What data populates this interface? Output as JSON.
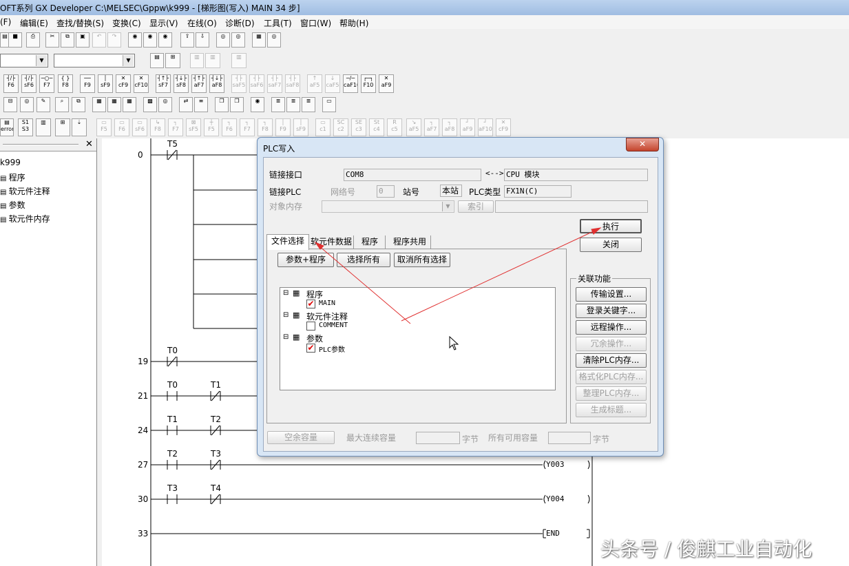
{
  "window": {
    "title": "OFT系列 GX Developer C:\\MELSEC\\Gppw\\k999 - [梯形图(写入)     MAIN    34 步]"
  },
  "menu": [
    "(F)",
    "编辑(E)",
    "查找/替换(S)",
    "变换(C)",
    "显示(V)",
    "在线(O)",
    "诊断(D)",
    "工具(T)",
    "窗口(W)",
    "帮助(H)"
  ],
  "toolbar3": [
    "F6",
    "sF6",
    "F7",
    "F8",
    "F9",
    "sF9",
    "cF9",
    "cF10",
    "sF7",
    "sF8",
    "aF7",
    "aF8",
    "saF5",
    "saF6",
    "saF7",
    "saF8",
    "aF5",
    "caF5",
    "caF10",
    "F10",
    "aF9"
  ],
  "toolbar5": [
    "F5",
    "F6",
    "sF6",
    "F8",
    "F7",
    "sF5",
    "F5",
    "F6",
    "F7",
    "F8",
    "F9",
    "sF9",
    "c1",
    "c2",
    "c3",
    "c4",
    "c5",
    "aF5",
    "aF7",
    "aF8",
    "aF9",
    "aF10",
    "cF9"
  ],
  "project": {
    "root": "k999",
    "items": [
      "程序",
      "软元件注释",
      "参数",
      "软元件内存"
    ]
  },
  "ladder": {
    "steps": [
      "0",
      "19",
      "21",
      "24",
      "27",
      "30",
      "33"
    ],
    "contacts": [
      "T5",
      "T0",
      "T0",
      "T1",
      "T1",
      "T2",
      "T2",
      "T3",
      "T3",
      "T4"
    ],
    "coils": [
      "Y003",
      "Y004",
      "END"
    ]
  },
  "dialog": {
    "title": "PLC写入",
    "link_interface_label": "链接接口",
    "link_interface_value": "COM8",
    "arrow": "<-->",
    "cpu_module": "CPU 模块",
    "link_plc_label": "链接PLC",
    "network_label": "网络号",
    "network_value": "0",
    "station_label": "站号",
    "station_value": "本站",
    "plc_type_label": "PLC类型",
    "plc_type_value": "FX1N(C)",
    "target_memory_label": "对象内存",
    "index_label": "索引",
    "tabs": [
      "文件选择",
      "软元件数据",
      "程序",
      "程序共用"
    ],
    "buttons": {
      "param_program": "参数+程序",
      "select_all": "选择所有",
      "deselect_all": "取消所有选择",
      "execute": "执行",
      "close": "关闭"
    },
    "tree": {
      "program": "程序",
      "main": "MAIN",
      "device_comment": "软元件注释",
      "comment": "COMMENT",
      "parameter": "参数",
      "plc_param": "PLC参数"
    },
    "related": {
      "title": "关联功能",
      "items": [
        "传输设置...",
        "登录关键字...",
        "远程操作...",
        "冗余操作...",
        "清除PLC内存...",
        "格式化PLC内存...",
        "整理PLC内存...",
        "生成标题..."
      ]
    },
    "bottom": {
      "free_space": "空余容量",
      "max_continuous": "最大连续容量",
      "bytes1": "字节",
      "all_available": "所有可用容量",
      "bytes2": "字节"
    }
  },
  "watermark": "头条号 / 俊麒工业自动化"
}
